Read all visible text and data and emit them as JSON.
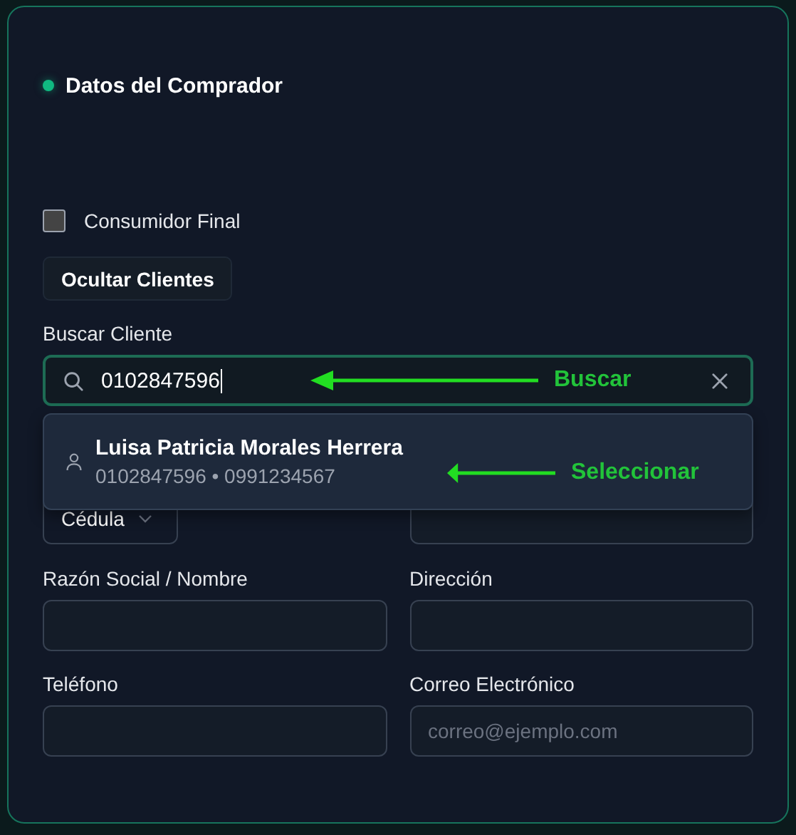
{
  "section": {
    "title": "Datos del Comprador"
  },
  "consumer_final": {
    "label": "Consumidor Final",
    "checked": false
  },
  "toggle_button": "Ocultar Clientes",
  "search": {
    "label": "Buscar Cliente",
    "value": "0102847596"
  },
  "results": [
    {
      "name": "Luisa Patricia Morales Herrera",
      "detail": "0102847596 • 0991234567"
    }
  ],
  "id_type": {
    "value": "Cédula"
  },
  "fields": [
    {
      "label": "Razón Social / Nombre"
    },
    {
      "label": "Dirección"
    },
    {
      "label": "Teléfono"
    },
    {
      "label": "Correo Electrónico",
      "placeholder": "correo@ejemplo.com"
    }
  ],
  "annotations": [
    {
      "text": "Buscar"
    },
    {
      "text": "Seleccionar"
    }
  ]
}
